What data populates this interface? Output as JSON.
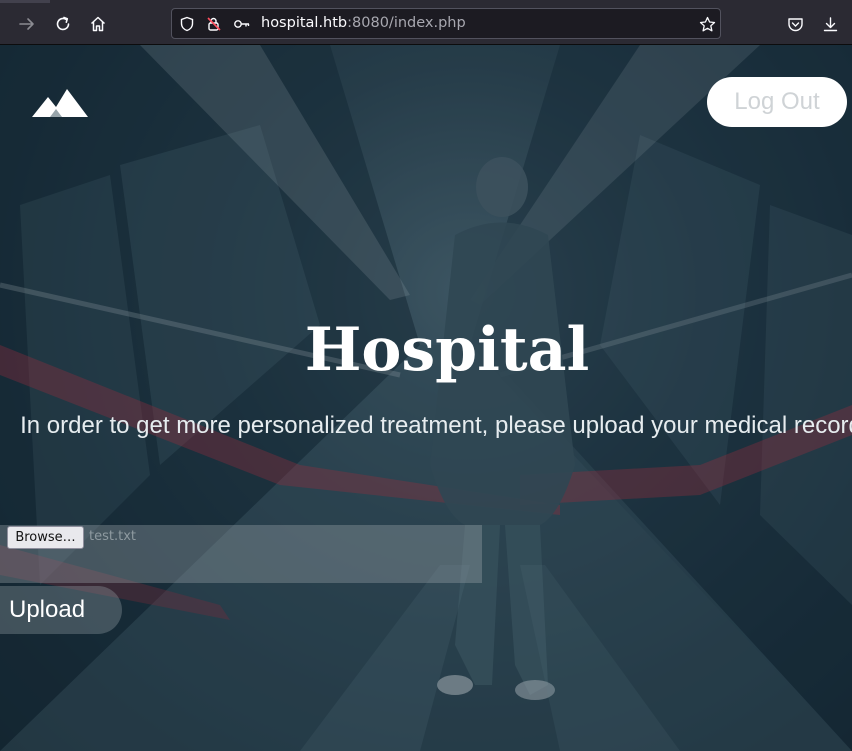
{
  "browser": {
    "url_host": "hospital.htb",
    "url_rest": ":8080/index.php"
  },
  "header": {
    "logout_label": "Log Out"
  },
  "hero": {
    "title": "Hospital",
    "subtitle": "In order to get more personalized treatment, please upload your medical records"
  },
  "upload_form": {
    "browse_label": "Browse…",
    "file_name": "test.txt",
    "upload_label": "Upload"
  },
  "colors": {
    "toolbar_bg": "#2b2a33",
    "urlbar_bg": "#1c1b22",
    "logout_bg": "#ffffff",
    "hero_title": "#ffffff"
  },
  "icons": [
    "forward-arrow-icon",
    "reload-icon",
    "home-icon",
    "shield-icon",
    "lock-warning-icon",
    "key-icon",
    "star-icon",
    "pocket-icon",
    "download-icon",
    "mountain-logo-icon"
  ]
}
